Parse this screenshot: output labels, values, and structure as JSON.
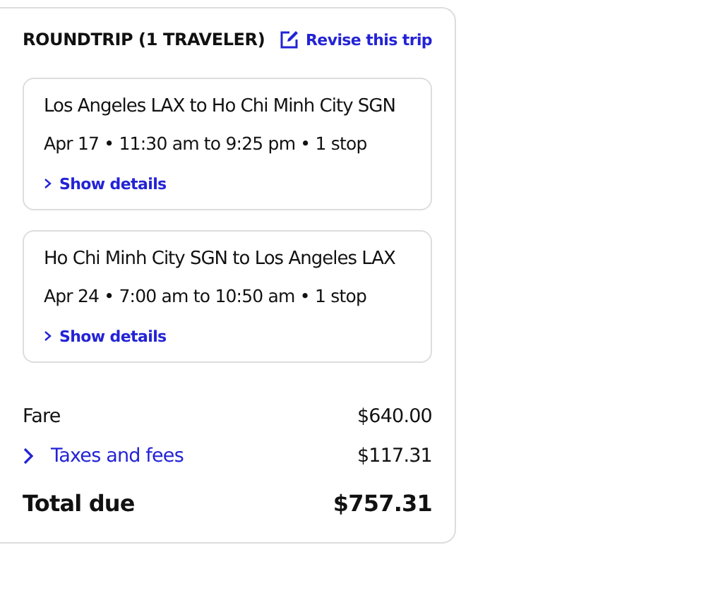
{
  "header": {
    "title": "ROUNDTRIP (1 TRAVELER)",
    "revise_link": "Revise this trip"
  },
  "legs": [
    {
      "route": "Los Angeles LAX to Ho Chi Minh City SGN",
      "schedule": "Apr 17 • 11:30 am to 9:25 pm • 1 stop",
      "details_link": "Show details"
    },
    {
      "route": "Ho Chi Minh City SGN to Los Angeles LAX",
      "schedule": "Apr 24 • 7:00 am to 10:50 am • 1 stop",
      "details_link": "Show details"
    }
  ],
  "prices": [
    {
      "kind": "plain",
      "label": "Fare",
      "amount": "$640.00"
    },
    {
      "kind": "expandable",
      "label": "Taxes and fees",
      "amount": "$117.31"
    },
    {
      "kind": "total",
      "label": "Total due",
      "amount": "$757.31"
    }
  ]
}
